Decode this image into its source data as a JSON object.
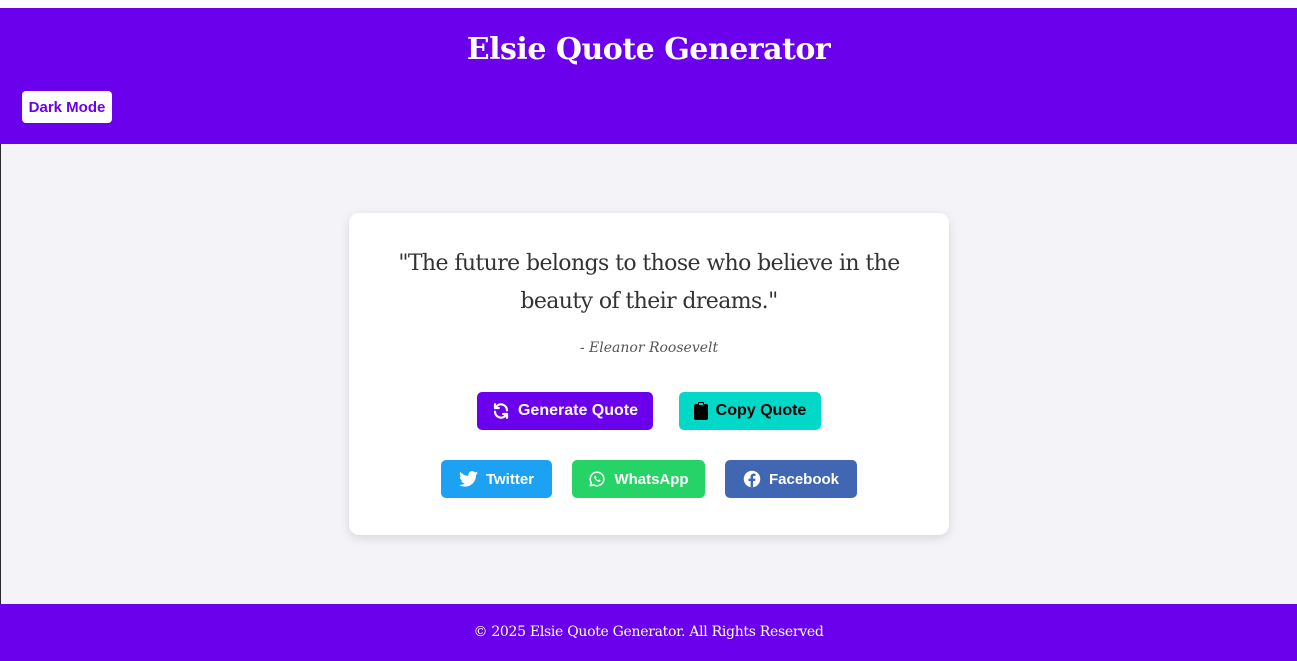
{
  "header": {
    "title": "Elsie Quote Generator",
    "dark_mode_label": "Dark Mode"
  },
  "quote": {
    "text": "\"The future belongs to those who believe in the beauty of their dreams.\"",
    "author": "- Eleanor Roosevelt"
  },
  "actions": {
    "generate_label": "Generate Quote",
    "generate_icon": "refresh-icon",
    "copy_label": "Copy Quote",
    "copy_icon": "clipboard-icon"
  },
  "share": {
    "twitter_label": "Twitter",
    "whatsapp_label": "WhatsApp",
    "facebook_label": "Facebook"
  },
  "footer": {
    "text": "© 2025 Elsie Quote Generator. All Rights Reserved"
  },
  "colors": {
    "brand": "#6a00ec",
    "copy": "#00d8c8",
    "twitter": "#1da1f2",
    "whatsapp": "#25d366",
    "facebook": "#4267b2",
    "background": "#f4f4f8"
  }
}
